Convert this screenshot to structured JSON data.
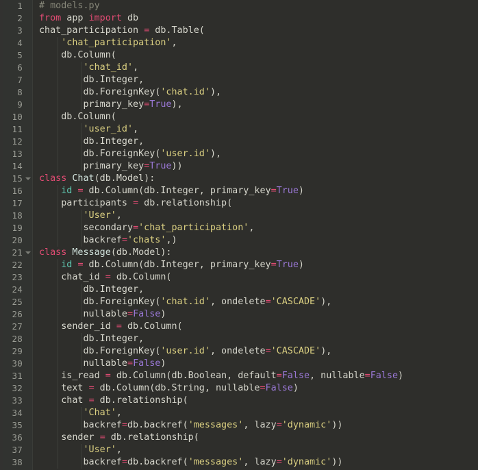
{
  "editor": {
    "language": "python",
    "theme": "dark",
    "filename_comment": "# models.py",
    "first_visible_line": 1,
    "last_visible_line": 38,
    "line_height_px": 18,
    "colors": {
      "background": "#2e2e2b",
      "gutter_background": "#313330",
      "edge_strip": "#323230",
      "line_number": "#9a9c94",
      "indent_guide": "#3d3f3a",
      "text": "#d6d6cc",
      "comment": "#88887a",
      "keyword": "#e34c74",
      "string": "#dacf81",
      "constant": "#9a78d6",
      "operator": "#e34c74",
      "variable": "#5fc8b1",
      "class_name": "#cfe0da"
    },
    "fold_markers": [
      {
        "line": 15,
        "state": "open"
      },
      {
        "line": 21,
        "state": "open"
      }
    ],
    "indent_guides": [
      {
        "x": 27,
        "from_line": 4,
        "to_line": 14
      },
      {
        "x": 61,
        "from_line": 6,
        "to_line": 9
      },
      {
        "x": 61,
        "from_line": 11,
        "to_line": 14
      },
      {
        "x": 27,
        "from_line": 16,
        "to_line": 20
      },
      {
        "x": 61,
        "from_line": 18,
        "to_line": 20
      },
      {
        "x": 27,
        "from_line": 22,
        "to_line": 38
      },
      {
        "x": 61,
        "from_line": 24,
        "to_line": 26
      },
      {
        "x": 61,
        "from_line": 28,
        "to_line": 30
      },
      {
        "x": 61,
        "from_line": 34,
        "to_line": 35
      },
      {
        "x": 61,
        "from_line": 37,
        "to_line": 38
      }
    ],
    "lines": [
      {
        "n": 1,
        "tokens": [
          {
            "t": "comment",
            "v": "# models.py"
          }
        ]
      },
      {
        "n": 2,
        "tokens": [
          {
            "t": "kw",
            "v": "from"
          },
          {
            "t": "plain",
            "v": " app "
          },
          {
            "t": "kw",
            "v": "import"
          },
          {
            "t": "plain",
            "v": " db"
          }
        ]
      },
      {
        "n": 3,
        "tokens": [
          {
            "t": "plain",
            "v": "chat_participation "
          },
          {
            "t": "op",
            "v": "="
          },
          {
            "t": "plain",
            "v": " db.Table("
          }
        ]
      },
      {
        "n": 4,
        "tokens": [
          {
            "t": "plain",
            "v": "    "
          },
          {
            "t": "str",
            "v": "'chat_participation'"
          },
          {
            "t": "plain",
            "v": ","
          }
        ]
      },
      {
        "n": 5,
        "tokens": [
          {
            "t": "plain",
            "v": "    db.Column("
          }
        ]
      },
      {
        "n": 6,
        "tokens": [
          {
            "t": "plain",
            "v": "        "
          },
          {
            "t": "str",
            "v": "'chat_id'"
          },
          {
            "t": "plain",
            "v": ","
          }
        ]
      },
      {
        "n": 7,
        "tokens": [
          {
            "t": "plain",
            "v": "        db.Integer,"
          }
        ]
      },
      {
        "n": 8,
        "tokens": [
          {
            "t": "plain",
            "v": "        db.ForeignKey("
          },
          {
            "t": "str",
            "v": "'chat.id'"
          },
          {
            "t": "plain",
            "v": "),"
          }
        ]
      },
      {
        "n": 9,
        "tokens": [
          {
            "t": "plain",
            "v": "        primary_key"
          },
          {
            "t": "op",
            "v": "="
          },
          {
            "t": "const",
            "v": "True"
          },
          {
            "t": "plain",
            "v": "),"
          }
        ]
      },
      {
        "n": 10,
        "tokens": [
          {
            "t": "plain",
            "v": "    db.Column("
          }
        ]
      },
      {
        "n": 11,
        "tokens": [
          {
            "t": "plain",
            "v": "        "
          },
          {
            "t": "str",
            "v": "'user_id'"
          },
          {
            "t": "plain",
            "v": ","
          }
        ]
      },
      {
        "n": 12,
        "tokens": [
          {
            "t": "plain",
            "v": "        db.Integer,"
          }
        ]
      },
      {
        "n": 13,
        "tokens": [
          {
            "t": "plain",
            "v": "        db.ForeignKey("
          },
          {
            "t": "str",
            "v": "'user.id'"
          },
          {
            "t": "plain",
            "v": "),"
          }
        ]
      },
      {
        "n": 14,
        "tokens": [
          {
            "t": "plain",
            "v": "        primary_key"
          },
          {
            "t": "op",
            "v": "="
          },
          {
            "t": "const",
            "v": "True"
          },
          {
            "t": "plain",
            "v": "))"
          }
        ]
      },
      {
        "n": 15,
        "tokens": [
          {
            "t": "kw",
            "v": "class"
          },
          {
            "t": "plain",
            "v": " "
          },
          {
            "t": "cls",
            "v": "Chat"
          },
          {
            "t": "plain",
            "v": "(db.Model):"
          }
        ]
      },
      {
        "n": 16,
        "tokens": [
          {
            "t": "plain",
            "v": "    "
          },
          {
            "t": "var",
            "v": "id"
          },
          {
            "t": "plain",
            "v": " "
          },
          {
            "t": "op",
            "v": "="
          },
          {
            "t": "plain",
            "v": " db.Column(db.Integer, primary_key"
          },
          {
            "t": "op",
            "v": "="
          },
          {
            "t": "const",
            "v": "True"
          },
          {
            "t": "plain",
            "v": ")"
          }
        ]
      },
      {
        "n": 17,
        "tokens": [
          {
            "t": "plain",
            "v": "    participants "
          },
          {
            "t": "op",
            "v": "="
          },
          {
            "t": "plain",
            "v": " db.relationship("
          }
        ]
      },
      {
        "n": 18,
        "tokens": [
          {
            "t": "plain",
            "v": "        "
          },
          {
            "t": "str",
            "v": "'User'"
          },
          {
            "t": "plain",
            "v": ","
          }
        ]
      },
      {
        "n": 19,
        "tokens": [
          {
            "t": "plain",
            "v": "        secondary"
          },
          {
            "t": "op",
            "v": "="
          },
          {
            "t": "str",
            "v": "'chat_participation'"
          },
          {
            "t": "plain",
            "v": ","
          }
        ]
      },
      {
        "n": 20,
        "tokens": [
          {
            "t": "plain",
            "v": "        backref"
          },
          {
            "t": "op",
            "v": "="
          },
          {
            "t": "str",
            "v": "'chats'"
          },
          {
            "t": "plain",
            "v": ",)"
          }
        ]
      },
      {
        "n": 21,
        "tokens": [
          {
            "t": "kw",
            "v": "class"
          },
          {
            "t": "plain",
            "v": " "
          },
          {
            "t": "cls",
            "v": "Message"
          },
          {
            "t": "plain",
            "v": "(db.Model):"
          }
        ]
      },
      {
        "n": 22,
        "tokens": [
          {
            "t": "plain",
            "v": "    "
          },
          {
            "t": "var",
            "v": "id"
          },
          {
            "t": "plain",
            "v": " "
          },
          {
            "t": "op",
            "v": "="
          },
          {
            "t": "plain",
            "v": " db.Column(db.Integer, primary_key"
          },
          {
            "t": "op",
            "v": "="
          },
          {
            "t": "const",
            "v": "True"
          },
          {
            "t": "plain",
            "v": ")"
          }
        ]
      },
      {
        "n": 23,
        "tokens": [
          {
            "t": "plain",
            "v": "    chat_id "
          },
          {
            "t": "op",
            "v": "="
          },
          {
            "t": "plain",
            "v": " db.Column("
          }
        ]
      },
      {
        "n": 24,
        "tokens": [
          {
            "t": "plain",
            "v": "        db.Integer,"
          }
        ]
      },
      {
        "n": 25,
        "tokens": [
          {
            "t": "plain",
            "v": "        db.ForeignKey("
          },
          {
            "t": "str",
            "v": "'chat.id'"
          },
          {
            "t": "plain",
            "v": ", ondelete"
          },
          {
            "t": "op",
            "v": "="
          },
          {
            "t": "str",
            "v": "'CASCADE'"
          },
          {
            "t": "plain",
            "v": "),"
          }
        ]
      },
      {
        "n": 26,
        "tokens": [
          {
            "t": "plain",
            "v": "        nullable"
          },
          {
            "t": "op",
            "v": "="
          },
          {
            "t": "const",
            "v": "False"
          },
          {
            "t": "plain",
            "v": ")"
          }
        ]
      },
      {
        "n": 27,
        "tokens": [
          {
            "t": "plain",
            "v": "    sender_id "
          },
          {
            "t": "op",
            "v": "="
          },
          {
            "t": "plain",
            "v": " db.Column("
          }
        ]
      },
      {
        "n": 28,
        "tokens": [
          {
            "t": "plain",
            "v": "        db.Integer,"
          }
        ]
      },
      {
        "n": 29,
        "tokens": [
          {
            "t": "plain",
            "v": "        db.ForeignKey("
          },
          {
            "t": "str",
            "v": "'user.id'"
          },
          {
            "t": "plain",
            "v": ", ondelete"
          },
          {
            "t": "op",
            "v": "="
          },
          {
            "t": "str",
            "v": "'CASCADE'"
          },
          {
            "t": "plain",
            "v": "),"
          }
        ]
      },
      {
        "n": 30,
        "tokens": [
          {
            "t": "plain",
            "v": "        nullable"
          },
          {
            "t": "op",
            "v": "="
          },
          {
            "t": "const",
            "v": "False"
          },
          {
            "t": "plain",
            "v": ")"
          }
        ]
      },
      {
        "n": 31,
        "tokens": [
          {
            "t": "plain",
            "v": "    is_read "
          },
          {
            "t": "op",
            "v": "="
          },
          {
            "t": "plain",
            "v": " db.Column(db.Boolean, default"
          },
          {
            "t": "op",
            "v": "="
          },
          {
            "t": "const",
            "v": "False"
          },
          {
            "t": "plain",
            "v": ", nullable"
          },
          {
            "t": "op",
            "v": "="
          },
          {
            "t": "const",
            "v": "False"
          },
          {
            "t": "plain",
            "v": ")"
          }
        ]
      },
      {
        "n": 32,
        "tokens": [
          {
            "t": "plain",
            "v": "    text "
          },
          {
            "t": "op",
            "v": "="
          },
          {
            "t": "plain",
            "v": " db.Column(db.String, nullable"
          },
          {
            "t": "op",
            "v": "="
          },
          {
            "t": "const",
            "v": "False"
          },
          {
            "t": "plain",
            "v": ")"
          }
        ]
      },
      {
        "n": 33,
        "tokens": [
          {
            "t": "plain",
            "v": "    chat "
          },
          {
            "t": "op",
            "v": "="
          },
          {
            "t": "plain",
            "v": " db.relationship("
          }
        ]
      },
      {
        "n": 34,
        "tokens": [
          {
            "t": "plain",
            "v": "        "
          },
          {
            "t": "str",
            "v": "'Chat'"
          },
          {
            "t": "plain",
            "v": ","
          }
        ]
      },
      {
        "n": 35,
        "tokens": [
          {
            "t": "plain",
            "v": "        backref"
          },
          {
            "t": "op",
            "v": "="
          },
          {
            "t": "plain",
            "v": "db.backref("
          },
          {
            "t": "str",
            "v": "'messages'"
          },
          {
            "t": "plain",
            "v": ", lazy"
          },
          {
            "t": "op",
            "v": "="
          },
          {
            "t": "str",
            "v": "'dynamic'"
          },
          {
            "t": "plain",
            "v": "))"
          }
        ]
      },
      {
        "n": 36,
        "tokens": [
          {
            "t": "plain",
            "v": "    sender "
          },
          {
            "t": "op",
            "v": "="
          },
          {
            "t": "plain",
            "v": " db.relationship("
          }
        ]
      },
      {
        "n": 37,
        "tokens": [
          {
            "t": "plain",
            "v": "        "
          },
          {
            "t": "str",
            "v": "'User'"
          },
          {
            "t": "plain",
            "v": ","
          }
        ]
      },
      {
        "n": 38,
        "tokens": [
          {
            "t": "plain",
            "v": "        backref"
          },
          {
            "t": "op",
            "v": "="
          },
          {
            "t": "plain",
            "v": "db.backref("
          },
          {
            "t": "str",
            "v": "'messages'"
          },
          {
            "t": "plain",
            "v": ", lazy"
          },
          {
            "t": "op",
            "v": "="
          },
          {
            "t": "str",
            "v": "'dynamic'"
          },
          {
            "t": "plain",
            "v": "))"
          }
        ]
      }
    ]
  }
}
